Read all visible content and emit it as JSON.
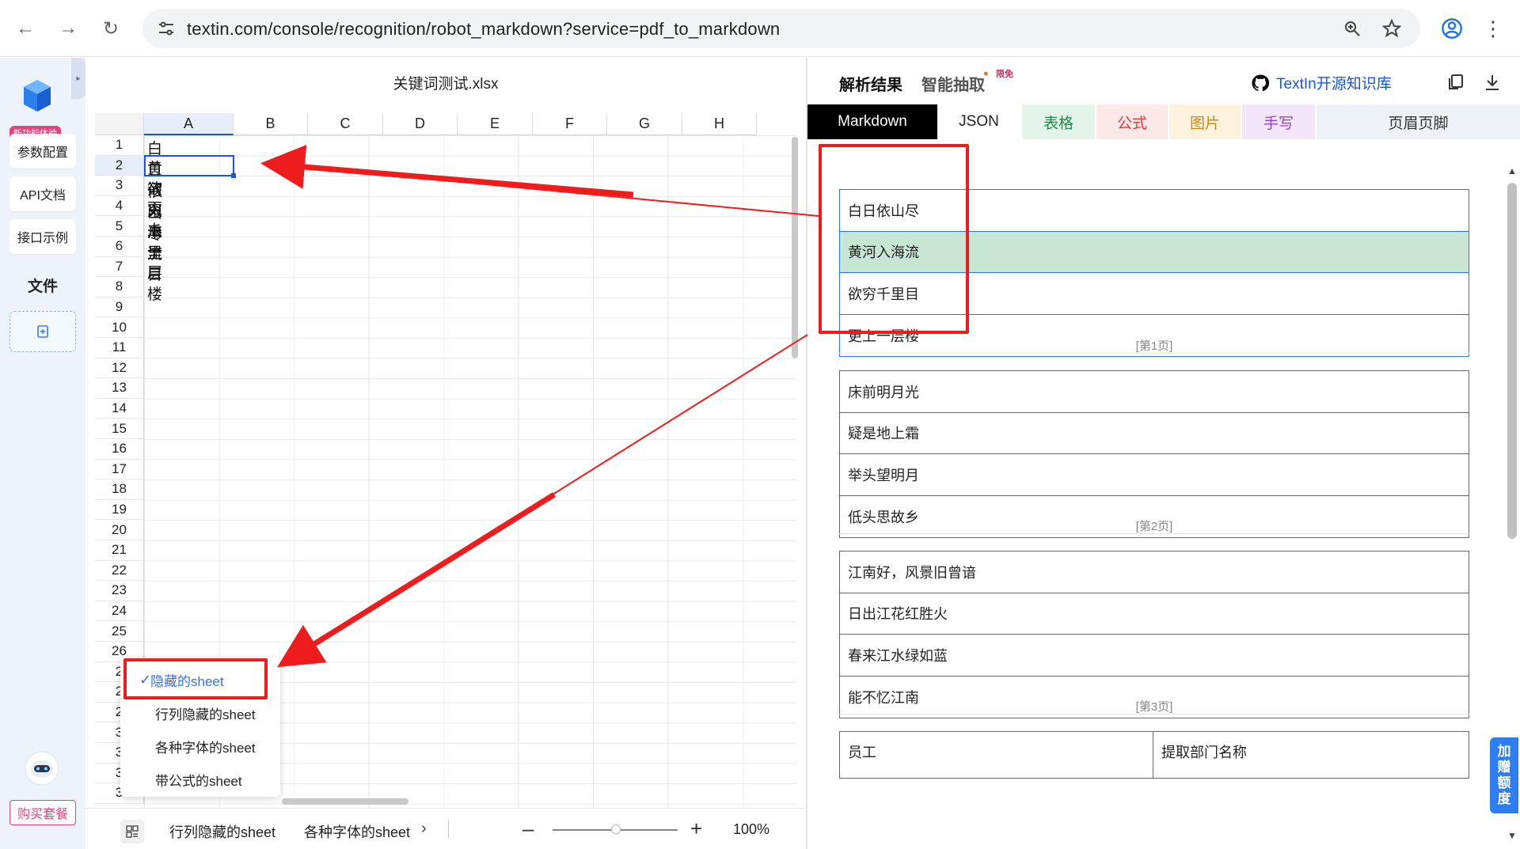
{
  "browser": {
    "url": "textin.com/console/recognition/robot_markdown?service=pdf_to_markdown"
  },
  "sidebar": {
    "new_badge": "新功能体验",
    "items": [
      {
        "label": "参数配置"
      },
      {
        "label": "API文档"
      },
      {
        "label": "接口示例"
      }
    ],
    "files_heading": "文件",
    "buy_label": "购买套餐"
  },
  "sheet": {
    "file_title": "关键词测试.xlsx",
    "columns": [
      "A",
      "B",
      "C",
      "D",
      "E",
      "F",
      "G",
      "H"
    ],
    "rows": [
      "1",
      "2",
      "3",
      "4",
      "5",
      "6",
      "7",
      "8",
      "9",
      "10",
      "11",
      "12",
      "13",
      "14",
      "15",
      "16",
      "17",
      "18",
      "19",
      "20",
      "21",
      "22",
      "23",
      "24",
      "25",
      "26",
      "2",
      "2",
      "2",
      "3",
      "3",
      "3",
      "3"
    ],
    "cells": [
      "白日依山尽",
      "黄河入海流",
      "欲穷千里目",
      "更上一层楼"
    ],
    "menu": [
      {
        "label": "隐藏的sheet",
        "active": true
      },
      {
        "label": "行列隐藏的sheet",
        "active": false
      },
      {
        "label": "各种字体的sheet",
        "active": false
      },
      {
        "label": "带公式的sheet",
        "active": false
      }
    ],
    "tabs": [
      "行列隐藏的sheet",
      "各种字体的sheet"
    ],
    "zoom": "100%"
  },
  "results": {
    "title": "解析结果",
    "second_tab": "智能抽取",
    "limited_badge": "限免",
    "kb_link": "TextIn开源知识库",
    "format_tabs": [
      {
        "label": "Markdown",
        "bg": "#000000",
        "fg": "#ffffff"
      },
      {
        "label": "JSON",
        "bg": "#ffffff",
        "fg": "#222222"
      },
      {
        "label": "表格",
        "bg": "#e3f5ea",
        "fg": "#1e8a4a"
      },
      {
        "label": "公式",
        "bg": "#fde8e8",
        "fg": "#e03b3b"
      },
      {
        "label": "图片",
        "bg": "#fdf3dc",
        "fg": "#c98a12"
      },
      {
        "label": "手写",
        "bg": "#f3e6fb",
        "fg": "#9a3fcf"
      },
      {
        "label": "页眉页脚",
        "bg": "#eef1f6",
        "fg": "#333333"
      }
    ],
    "pages": [
      {
        "rows": [
          "白日依山尽",
          "黄河入海流",
          "欲穷千里目",
          "更上一层楼"
        ],
        "label": "[第1页]"
      },
      {
        "rows": [
          "床前明月光",
          "疑是地上霜",
          "举头望明月",
          "低头思故乡"
        ],
        "label": "[第2页]"
      },
      {
        "rows": [
          "江南好，风景旧曾谙",
          "日出江花红胜火",
          "春来江水绿如蓝",
          "能不忆江南"
        ],
        "label": "[第3页]"
      }
    ],
    "partial_table": [
      "员工",
      "提取部门名称"
    ],
    "bonus": [
      "加",
      "赠",
      "额",
      "度"
    ]
  },
  "colors": {
    "accent": "#1a56db",
    "annotation": "#ee1c1c",
    "highlight_row": "#c8e6d4",
    "brand_pink": "#e0457b"
  }
}
